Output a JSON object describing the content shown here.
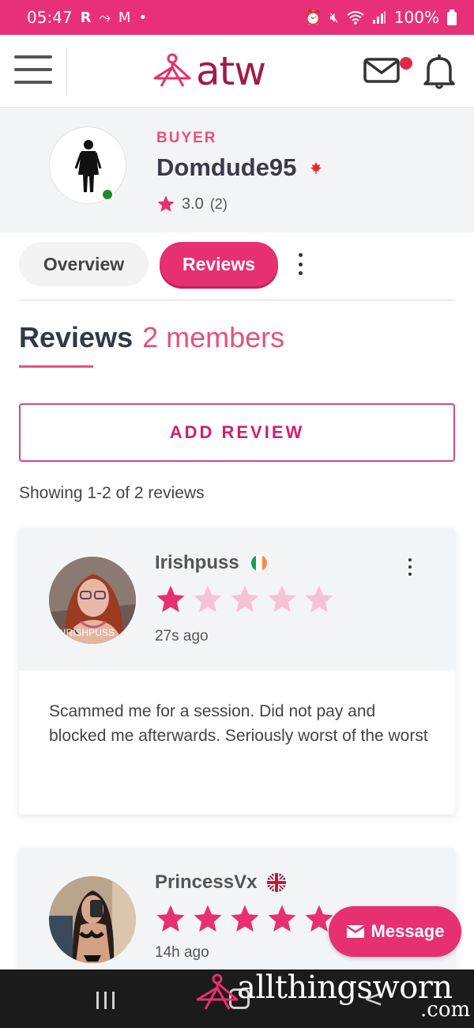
{
  "status_bar": {
    "time": "05:47",
    "left_icons": [
      "R",
      "⺀",
      "M",
      "•"
    ],
    "battery": "100%",
    "colors": {
      "background": "#e8307a"
    }
  },
  "header": {
    "logo_text": "atw",
    "menu_icon": "hamburger-icon",
    "mail_icon": "mail-icon",
    "bell_icon": "bell-icon"
  },
  "profile": {
    "role": "BUYER",
    "username": "Domdude95",
    "flag": "canada-flag-icon",
    "rating": "3.0",
    "rating_count": "(2)",
    "online": true
  },
  "tabs": [
    {
      "label": "Overview",
      "active": false
    },
    {
      "label": "Reviews",
      "active": true
    }
  ],
  "section": {
    "title": "Reviews",
    "subtitle": "2 members",
    "add_review_label": "ADD REVIEW",
    "showing_text": "Showing 1-2 of 2 reviews"
  },
  "reviews": [
    {
      "name": "Irishpuss",
      "flag": "ireland-flag-icon",
      "stars": 1,
      "max_stars": 5,
      "time": "27s ago",
      "avatar_watermark": "@IRISHPUSS",
      "text": "Scammed me for a session. Did not pay and blocked me afterwards. Seriously worst of the worst"
    },
    {
      "name": "PrincessVx",
      "flag": "uk-flag-icon",
      "stars": 5,
      "max_stars": 5,
      "time": "14h ago"
    }
  ],
  "message_button": {
    "label": "Message"
  },
  "watermark": {
    "text": "allthingsworn",
    "suffix": ".com"
  },
  "colors": {
    "brand": "#e6306f",
    "brand_dark": "#a01c46",
    "star_filled": "#e6306f",
    "star_empty": "#f6c3d4"
  }
}
